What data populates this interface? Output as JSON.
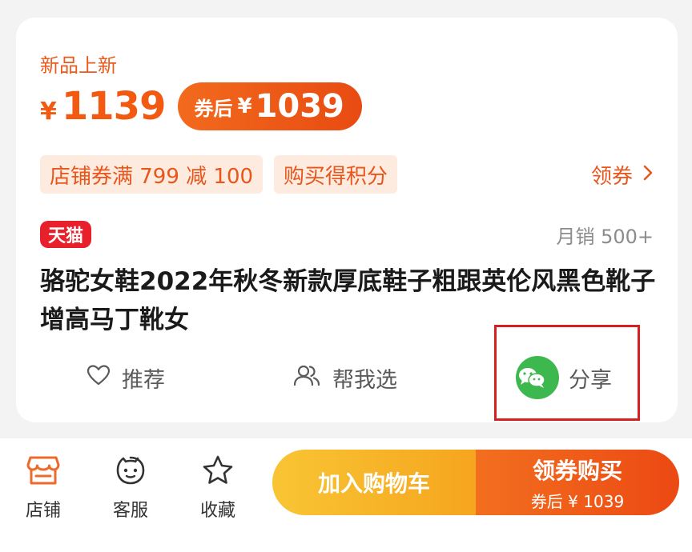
{
  "product": {
    "new_tag": "新品上新",
    "price_symbol": "¥",
    "price": "1139",
    "coupon_label": "券后",
    "coupon_symbol": "¥",
    "coupon_price": "1039",
    "promos": [
      "店铺券满 799 减 100",
      "购买得积分"
    ],
    "get_coupon": "领券",
    "platform_badge": "天猫",
    "monthly_sales": "月销 500+",
    "title": "骆驼女鞋2022年秋冬新款厚底鞋子粗跟英伦风黑色靴子增高马丁靴女"
  },
  "actions": {
    "recommend": "推荐",
    "help_choose": "帮我选",
    "share": "分享"
  },
  "bottom_nav": {
    "shop": "店铺",
    "service": "客服",
    "favorite": "收藏",
    "add_to_cart": "加入购物车",
    "buy_with_coupon": "领券购买",
    "buy_sub": "券后 ¥ 1039"
  },
  "colors": {
    "accent": "#f25a12",
    "tmall_red": "#e8202c",
    "cart_yellow": "#f6a51e",
    "wechat_green": "#3db84f",
    "highlight_red": "#d81e1e"
  },
  "icons": [
    "heart-icon",
    "people-icon",
    "wechat-icon",
    "chevron-right-icon",
    "shop-icon",
    "service-icon",
    "star-icon"
  ]
}
